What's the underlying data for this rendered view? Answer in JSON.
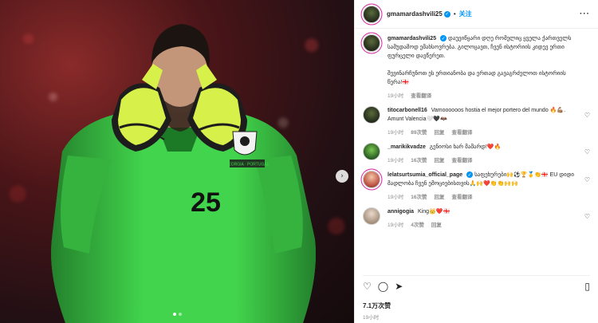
{
  "header": {
    "username": "gmamardashvili25",
    "follow_label": "关注",
    "more_label": "···"
  },
  "caption": {
    "username": "gmamardashvili25",
    "paragraph1": "დაუვიწყარი დღე რომელიც ყველა ქართველს სამუდამოდ ემახსოვრება. გილოცავთ, ჩვენ ისტორიის კიდევ ერთი ფურცელი დავწერეთ.",
    "paragraph2": "შევინარჩუნოთ ეს ერთიანობა და ერთად გავაგრძელოთ ისტორიის წერა!🇬🇪",
    "time": "19小时",
    "translate": "查看翻译"
  },
  "comments": [
    {
      "username": "titocarbonell16",
      "text": "Vamoooooos hostia el mejor portero del mundo 🔥💪🏽. Amunt Valencia🤍🖤🦇",
      "time": "19小时",
      "likes": "89次赞",
      "reply": "回复",
      "translate": "查看翻译"
    },
    {
      "username": "_marikikvadze",
      "text": "გენიოსი ხარ მამარდ!❤️🔥",
      "time": "19小时",
      "likes": "16次赞",
      "reply": "回复",
      "translate": "查看翻译"
    },
    {
      "username": "lelatsurtsumia_official_page",
      "text": "საფეხურები🙌⚽🏆🥇👏🇬🇪 EU დიდი მადლობა ჩვენ ემოციებისთვის🙏🙌❤️👏👏🙌🙌",
      "time": "19小时",
      "likes": "16次赞",
      "reply": "回复",
      "translate": "查看翻译"
    },
    {
      "username": "annigogia",
      "text": "King👑❤️🇬🇪",
      "time": "19小时",
      "likes": "4次赞",
      "reply": "回复",
      "translate": ""
    }
  ],
  "actions": {
    "like_icon": "heart-icon",
    "comment_icon": "comment-icon",
    "share_icon": "share-icon",
    "save_icon": "bookmark-icon"
  },
  "likes_count": "7.1万次赞",
  "post_time": "19小时",
  "photo": {
    "jersey_number": "25",
    "patch_text": "GEORGIA · PORTUGAL"
  },
  "colors": {
    "link_blue": "#0095f6",
    "jersey_green": "#3ecf4a",
    "meta_gray": "#8e8e8e"
  }
}
